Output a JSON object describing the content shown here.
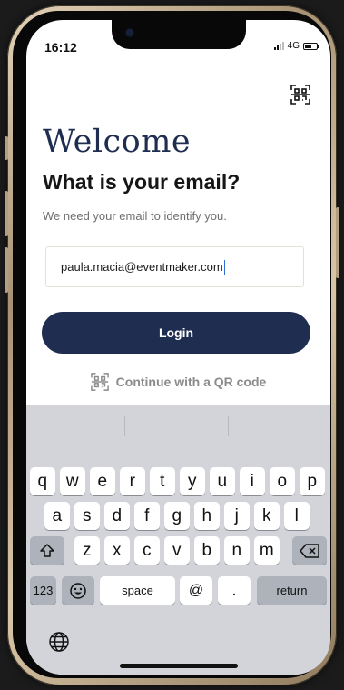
{
  "status": {
    "time": "16:12",
    "network": "4G"
  },
  "content": {
    "welcome": "Welcome",
    "question": "What is your email?",
    "subtitle": "We need your email to identify you.",
    "email_value": "paula.macia@eventmaker.com",
    "login_label": "Login",
    "qr_label": "Continue with a QR code"
  },
  "keyboard": {
    "row1": [
      "q",
      "w",
      "e",
      "r",
      "t",
      "y",
      "u",
      "i",
      "o",
      "p"
    ],
    "row2": [
      "a",
      "s",
      "d",
      "f",
      "g",
      "h",
      "j",
      "k",
      "l"
    ],
    "row3": [
      "z",
      "x",
      "c",
      "v",
      "b",
      "n",
      "m"
    ],
    "numbers_label": "123",
    "space_label": "space",
    "at_label": "@",
    "dot_label": ".",
    "return_label": "return"
  },
  "colors": {
    "brand": "#1f2d51",
    "keyboard_bg": "#d2d4da"
  },
  "icons": [
    "qr-scan-icon",
    "signal-icon",
    "battery-icon",
    "shift-icon",
    "backspace-icon",
    "emoji-icon",
    "globe-icon"
  ]
}
